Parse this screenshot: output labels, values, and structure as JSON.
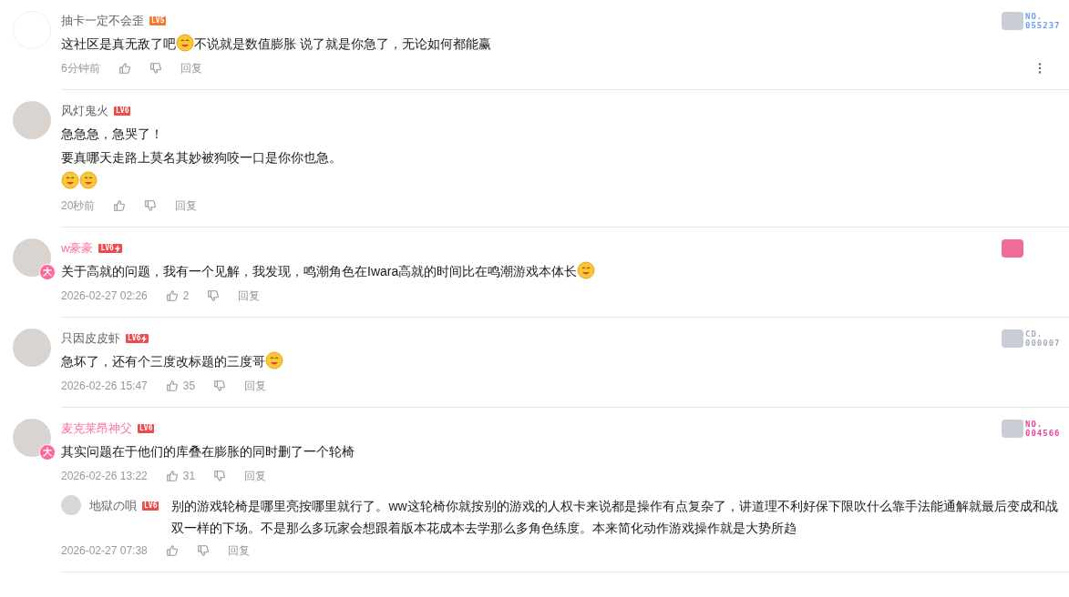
{
  "comments": [
    {
      "username": "抽卡一定不会歪",
      "vip": false,
      "rank": {
        "text": "LV5",
        "color": "#f5792a",
        "bolt": false
      },
      "fan_badge": {
        "line_1": "NO.",
        "line_2": "055237",
        "color": "#6b9df7"
      },
      "lines": [
        [
          {
            "kind": "text",
            "text": "这社区是真无敌了吧"
          },
          {
            "kind": "emoji"
          },
          {
            "kind": "text",
            "text": "不说就是数值膨胀 说了就是你急了，无论如何都能赢"
          }
        ]
      ],
      "time": "6分钟前",
      "reply_label": "回复",
      "menu": true
    },
    {
      "username": "风灯鬼火",
      "vip": false,
      "rank": {
        "text": "LV6",
        "color": "#ee4c4c",
        "bolt": false
      },
      "lines": [
        [
          {
            "kind": "text",
            "text": "急急急，急哭了！"
          }
        ],
        [
          {
            "kind": "text",
            "text": "要真哪天走路上莫名其妙被狗咬一口是你你也急。"
          }
        ],
        [
          {
            "kind": "emoji"
          },
          {
            "kind": "emoji"
          }
        ]
      ],
      "time": "20秒前",
      "reply_label": "回复",
      "menu": false
    },
    {
      "username": "w豪豪",
      "vip": true,
      "avatar_badge": "大",
      "rank": {
        "text": "LV6",
        "color": "#ee4c4c",
        "bolt": true
      },
      "fan_badge": {
        "color": "#f06a9a"
      },
      "lines": [
        [
          {
            "kind": "text",
            "text": "关于高就的问题，我有一个见解，我发现，鸣潮角色在Iwara高就的时间比在鸣潮游戏本体长"
          },
          {
            "kind": "emoji"
          }
        ]
      ],
      "time": "2026-02-27 02:26",
      "likes": "2",
      "reply_label": "回复",
      "menu": false
    },
    {
      "username": "只因皮皮虾",
      "vip": false,
      "rank": {
        "text": "LV6",
        "color": "#ee4c4c",
        "bolt": true
      },
      "fan_badge": {
        "line_1": "CD.",
        "line_2": "000007",
        "color": "#a4adbd"
      },
      "lines": [
        [
          {
            "kind": "text",
            "text": "急坏了，还有个三度改标题的三度哥"
          },
          {
            "kind": "emoji"
          }
        ]
      ],
      "time": "2026-02-26 15:47",
      "likes": "35",
      "reply_label": "回复",
      "menu": false
    },
    {
      "username": "麦克莱昂神父",
      "vip": true,
      "avatar_badge": "大",
      "rank": {
        "text": "LV6",
        "color": "#ee4c4c",
        "bolt": false
      },
      "fan_badge": {
        "line_1": "NO.",
        "line_2": "004566",
        "color": "#ee3fa0"
      },
      "lines": [
        [
          {
            "kind": "text",
            "text": "其实问题在于他们的库叠在膨胀的同时删了一个轮椅"
          }
        ]
      ],
      "time": "2026-02-26 13:22",
      "likes": "31",
      "reply_label": "回复",
      "menu": false,
      "children": [
        {
          "username": "地獄の唄",
          "rank": {
            "text": "LV6",
            "color": "#ee4c4c"
          },
          "text": "别的游戏轮椅是哪里亮按哪里就行了。ww这轮椅你就按别的游戏的人权卡来说都是操作有点复杂了，讲道理不利好保下限吹什么靠手法能通解就最后变成和战双一样的下场。不是那么多玩家会想跟着版本花成本去学那么多角色练度。本来简化动作游戏操作就是大势所趋",
          "time": "2026-02-27 07:38",
          "reply_label": "回复"
        }
      ]
    }
  ]
}
